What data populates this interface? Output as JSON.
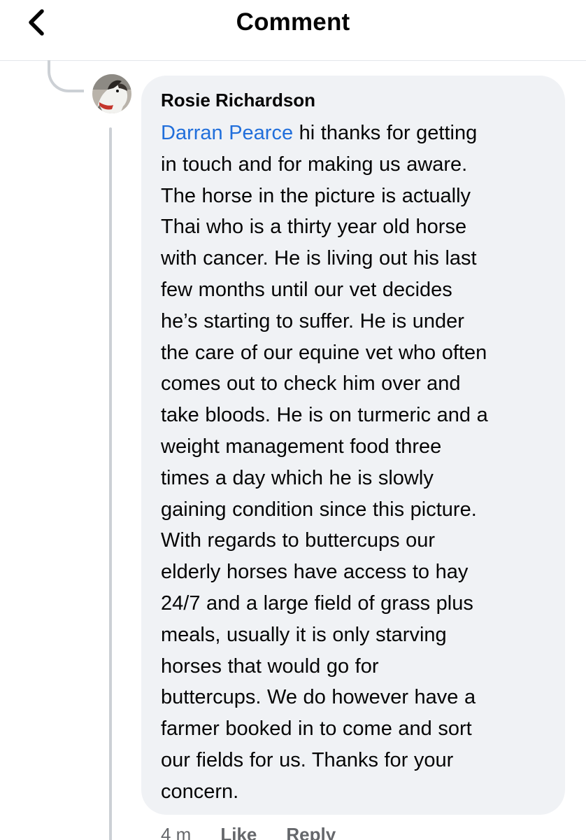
{
  "header": {
    "title": "Comment"
  },
  "comment": {
    "author": "Rosie Richardson",
    "mention": "Darran Pearce",
    "lines": [
      " hi thanks for getting",
      "in touch and for making us aware.",
      "The horse in the picture is actually",
      "Thai who is a thirty year old horse",
      "with cancer. He is living out his last",
      "few months until our vet decides",
      "he’s starting to suffer. He is under",
      "the care of our equine vet who often",
      "comes out to check him over and",
      "take bloods. He is on turmeric and a",
      "weight management food three",
      "times a day which he is slowly",
      "gaining condition since this picture.",
      "With regards to buttercups our",
      "elderly horses have access to hay",
      "24/7 and a large field of grass plus",
      "meals, usually it is only starving",
      "horses that would go for",
      "buttercups. We do however have a",
      "farmer booked in to come and sort",
      "our fields for us. Thanks for your",
      "concern."
    ],
    "timestamp": "4 m",
    "like_label": "Like",
    "reply_label": "Reply"
  },
  "icons": {
    "back": "chevron-left-icon",
    "avatar": "dog-avatar"
  },
  "colors": {
    "bubble_bg": "#f0f2f5",
    "mention": "#216fdb",
    "meta_text": "#65676b",
    "thread_line": "#ccd0d5"
  }
}
